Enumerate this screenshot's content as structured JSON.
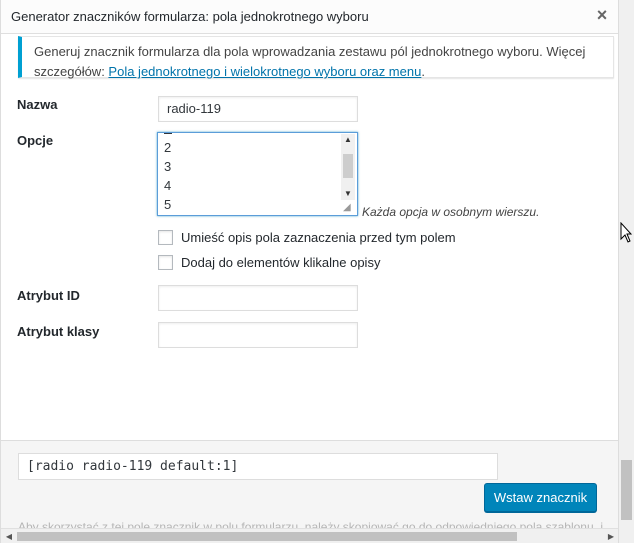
{
  "dialog": {
    "title": "Generator znaczników formularza: pola jednokrotnego wyboru",
    "close_glyph": "×"
  },
  "notice": {
    "text": "Generuj znacznik formularza dla pola wprowadzania zestawu pól jednokrotnego wyboru. Więcej szczegółów: ",
    "link": "Pola jednokrotnego i wielokrotnego wyboru oraz menu",
    "suffix": "."
  },
  "fields": {
    "name_label": "Nazwa",
    "name_value": "radio-119",
    "options_label": "Opcje",
    "options_visible_lines": [
      "2",
      "3",
      "4",
      "5"
    ],
    "options_hint": "Każda opcja w osobnym wierszu.",
    "checkbox_label_first": "Umieść opis pola zaznaczenia przed tym polem",
    "checkbox_clickable": "Dodaj do elementów klikalne opisy",
    "id_label": "Atrybut ID",
    "id_value": "",
    "class_label": "Atrybut klasy",
    "class_value": ""
  },
  "footer": {
    "shortcode": "[radio radio-119 default:1]",
    "insert_button": "Wstaw znacznik",
    "faded_text": "Aby skorzystać z tej pole znacznik w polu formularzu, należy skopiować go do odpowiedniego pola szablonu, i następnie wklej go w pole"
  },
  "colors": {
    "accent": "#0085ba",
    "notice_border": "#00a0d2",
    "link": "#0073aa"
  },
  "icons": {
    "close": "close-icon",
    "cursor": "mouse-pointer-icon"
  }
}
